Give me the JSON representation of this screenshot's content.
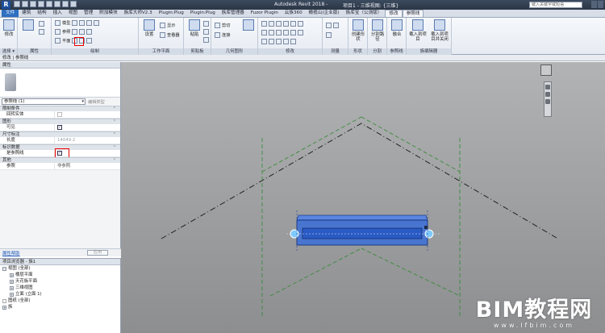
{
  "titlebar": {
    "app_title": "Autodesk Revit 2018 -",
    "doc_title": "项目1 - 三维视图: {三维}",
    "search_placeholder": "键入关键字或短语"
  },
  "tabs": [
    "建筑",
    "结构",
    "插入",
    "视图",
    "管理",
    "附加模块",
    "族库大师V2.3",
    "Plugin:Plug",
    "Plugin:Plug",
    "族库管理器",
    "Fuzor Plugin",
    "云族360",
    "橄榄山(企业版)",
    "族库宝（公测版）",
    "修改",
    "参照线"
  ],
  "file_tab": "文件",
  "active_tab": "修改 | 参照线",
  "ribbon": {
    "modify_label": "修改",
    "select_panel": "选择 ▾",
    "properties_panel": "属性",
    "draw_panel": "绘制",
    "workplane_panel": "工作平面",
    "workplane_set": "设置",
    "workplane_show": "显示",
    "workplane_viewer": "查看器",
    "clipboard_panel": "剪贴板",
    "clipboard_paste": "粘贴",
    "geometry_panel": "几何图形",
    "geometry_cut": "剪切",
    "geometry_join": "连接",
    "modify_panel": "修改",
    "measure_panel": "测量",
    "create_panel": "创建",
    "shape_panel": "形状",
    "create_form": "创建形状",
    "divide_panel": "分割",
    "divide_path": "分割路径",
    "mode_panel": "参照线",
    "fusion": "融合",
    "family_editor_panel": "族编辑器",
    "load_into_project": "载入到项目",
    "load_into_project_close": "载入到项目并关闭",
    "draw_plane": "平面",
    "draw_ref": "参照",
    "draw_model": "模型"
  },
  "context_bar": "修改 | 参照线",
  "properties": {
    "header": "属性",
    "type_name": "参照线 (1)",
    "edit_type": "编辑类型",
    "groups": [
      {
        "name": "限制条件",
        "rows": [
          {
            "key": "回转实体",
            "value": "",
            "checkbox": "disabled"
          }
        ]
      },
      {
        "name": "图形",
        "rows": [
          {
            "key": "可见",
            "value": "",
            "checkbox": "on"
          }
        ]
      },
      {
        "name": "尺寸标注",
        "rows": [
          {
            "key": "长度",
            "value": "14049.2",
            "checkbox": ""
          }
        ]
      },
      {
        "name": "标识数据",
        "rows": [
          {
            "key": "是参照线",
            "value": "",
            "checkbox": "on"
          }
        ]
      },
      {
        "name": "其他",
        "rows": [
          {
            "key": "参照",
            "value": "非参照",
            "checkbox": ""
          }
        ]
      }
    ],
    "help_link": "属性帮助",
    "apply_label": "应用"
  },
  "browser": {
    "header": "项目浏览器 - 族1",
    "nodes": [
      {
        "label": "视图 (全部)",
        "indent": 0,
        "toggle": "−"
      },
      {
        "label": "楼层平面",
        "indent": 1,
        "toggle": "+"
      },
      {
        "label": "天花板平面",
        "indent": 1,
        "toggle": "+"
      },
      {
        "label": "三维视图",
        "indent": 1,
        "toggle": "+"
      },
      {
        "label": "立面 (立面 1)",
        "indent": 1,
        "toggle": "+"
      },
      {
        "label": "图纸 (全部)",
        "indent": 0,
        "toggle": ""
      },
      {
        "label": "族",
        "indent": 0,
        "toggle": "+"
      }
    ]
  },
  "watermark": {
    "brand": "BIM教程网",
    "url": "www.lfbim.com"
  },
  "colors": {
    "selection_fill": "#3a6fd8",
    "highlight_box": "#e00000",
    "canvas_top": "#b2b3b5",
    "canvas_bottom": "#8d8e90"
  }
}
